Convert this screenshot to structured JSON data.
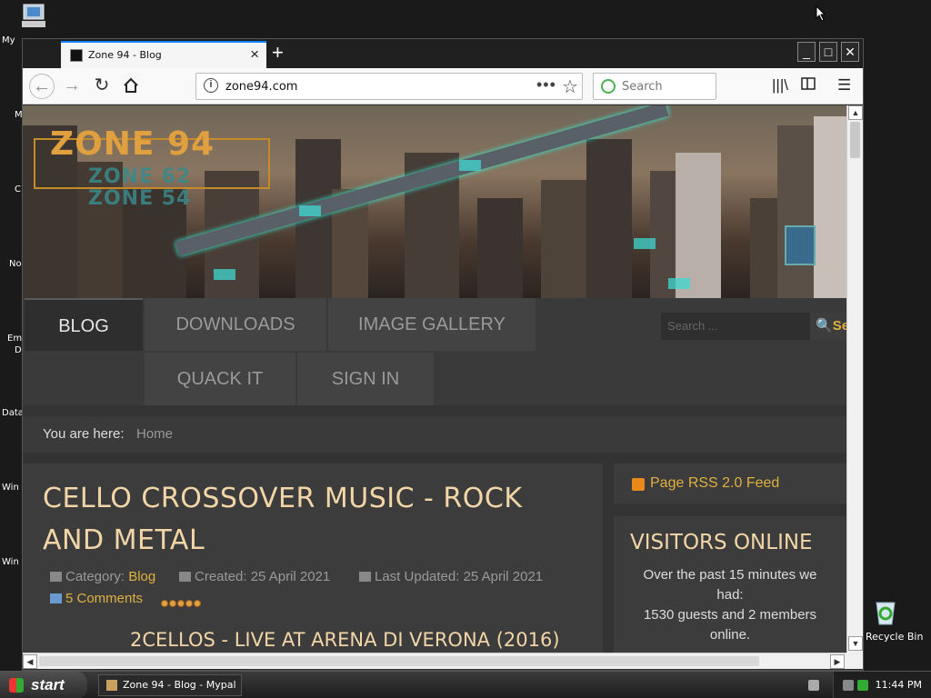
{
  "desktop": {
    "icon_labels": [
      "My",
      "M",
      "C",
      "No",
      "Em",
      "D",
      "Data",
      "Win",
      "Win"
    ],
    "recycle_bin_label": "Recycle Bin"
  },
  "browser": {
    "tab_title": "Zone 94 - Blog",
    "url": "zone94.com",
    "search_placeholder": "Search",
    "new_tab_label": "+",
    "tab_close_label": "×"
  },
  "site": {
    "logo_main": "ZONE 94",
    "logo_sub1": "ZONE 62",
    "logo_sub2": "ZONE 54",
    "menu": {
      "items": [
        "BLOG",
        "DOWNLOADS",
        "IMAGE GALLERY",
        "QUACK IT",
        "SIGN IN"
      ],
      "active": "BLOG"
    },
    "search_placeholder": "Search ...",
    "search_button": "Se",
    "breadcrumb": {
      "label": "You are here:",
      "home": "Home"
    },
    "article": {
      "title": "CELLO CROSSOVER MUSIC - ROCK AND METAL",
      "category_label": "Category:",
      "category": "Blog",
      "created": "Created: 25 April 2021",
      "updated": "Last Updated: 25 April 2021",
      "comments": "5 Comments",
      "rating": 5,
      "subheading": "2CELLOS - LIVE AT ARENA DI VERONA (2016)"
    },
    "sidebar": {
      "rss": "Page RSS 2.0 Feed",
      "visitors_title": "VISITORS ONLINE",
      "visitors_line1": "Over the past 15 minutes we had:",
      "visitors_line2": "1530 guests and 2 members online."
    }
  },
  "taskbar": {
    "start_label": "start",
    "task_label": "Zone 94 - Blog - Mypal",
    "clock": "11:44 PM"
  }
}
